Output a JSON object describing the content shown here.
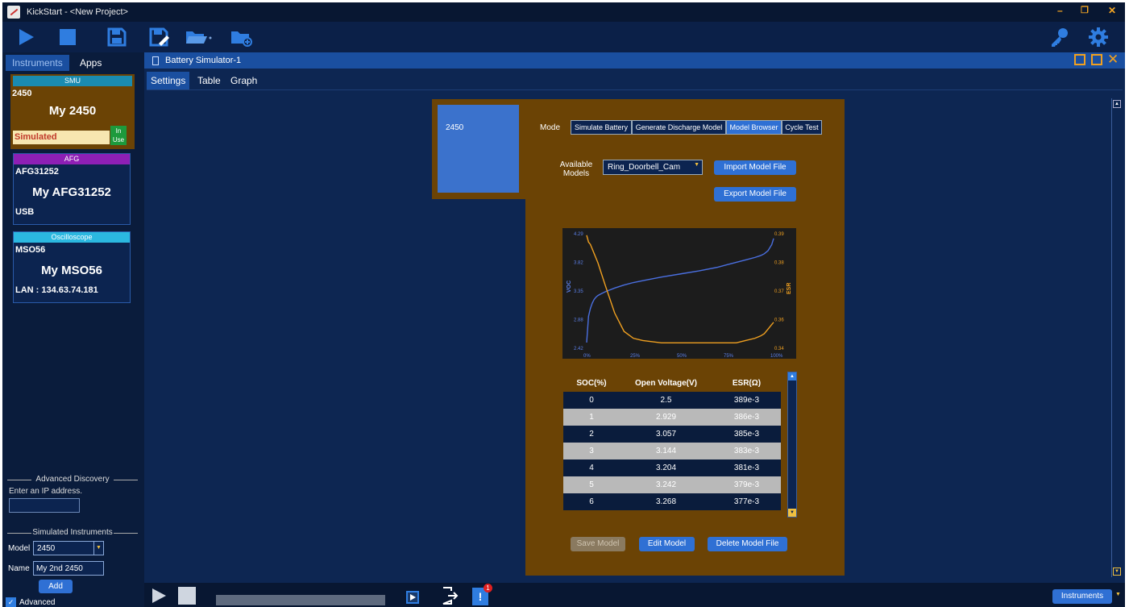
{
  "window": {
    "title": "KickStart - <New Project>"
  },
  "left_tabs": {
    "instruments": "Instruments",
    "apps": "Apps"
  },
  "instruments": [
    {
      "type": "SMU",
      "model": "2450",
      "name": "My 2450",
      "connection": "Simulated",
      "status": "In Use",
      "header_color": "#1a8bb0"
    },
    {
      "type": "AFG",
      "model": "AFG31252",
      "name": "My AFG31252",
      "connection": "USB",
      "header_color": "#8e1fb5"
    },
    {
      "type": "Oscilloscope",
      "model": "MSO56",
      "name": "My MSO56",
      "connection": "LAN : 134.63.74.181",
      "header_color": "#2bb8e0"
    }
  ],
  "advanced_discovery": {
    "label": "Advanced Discovery",
    "ip_prompt": "Enter an IP address.",
    "ip_value": ""
  },
  "simulated": {
    "label": "Simulated Instruments",
    "model_label": "Model",
    "model_value": "2450",
    "name_label": "Name",
    "name_value": "My 2nd 2450",
    "add_label": "Add",
    "advanced_label": "Advanced"
  },
  "doc": {
    "title": "Battery Simulator-1",
    "tabs": [
      "Settings",
      "Table",
      "Graph"
    ],
    "instrument_tile": "2450",
    "mode_label": "Mode",
    "modes": [
      "Simulate Battery",
      "Generate Discharge Model",
      "Model Browser",
      "Cycle Test"
    ],
    "active_mode": "Model Browser",
    "available_models_label": "Available Models",
    "selected_model": "Ring_Doorbell_Cam",
    "import_label": "Import Model File",
    "export_label": "Export Model File",
    "save_label": "Save Model",
    "edit_label": "Edit Model",
    "delete_label": "Delete Model File"
  },
  "chart_data": {
    "type": "line",
    "xlabel": "",
    "ylabel": "VOC",
    "y2label": "ESR",
    "x_ticks": [
      "0%",
      "25%",
      "50%",
      "75%",
      "100%"
    ],
    "y_ticks": [
      "4.29",
      "3.82",
      "3.35",
      "2.88",
      "2.42"
    ],
    "y2_ticks": [
      "0.39",
      "0.38",
      "0.37",
      "0.36",
      "0.34"
    ],
    "ylim": [
      2.42,
      4.29
    ],
    "y2lim": [
      0.34,
      0.39
    ],
    "series": [
      {
        "color": "#4a6fe0",
        "x": [
          0,
          1,
          2,
          3,
          4,
          5,
          6,
          8,
          10,
          15,
          20,
          25,
          30,
          40,
          50,
          60,
          70,
          75,
          80,
          85,
          90,
          93,
          95,
          97,
          99,
          100
        ],
        "values": [
          2.5,
          2.929,
          3.057,
          3.144,
          3.204,
          3.242,
          3.268,
          3.3,
          3.33,
          3.39,
          3.44,
          3.48,
          3.51,
          3.57,
          3.62,
          3.67,
          3.73,
          3.77,
          3.81,
          3.85,
          3.89,
          3.92,
          3.95,
          4.0,
          4.1,
          4.2
        ]
      },
      {
        "color": "#f0a020",
        "x": [
          0,
          1,
          2,
          3,
          4,
          5,
          6,
          8,
          10,
          15,
          20,
          25,
          30,
          40,
          50,
          60,
          70,
          75,
          80,
          85,
          90,
          93,
          95,
          97,
          99,
          100
        ],
        "values": [
          0.389,
          0.386,
          0.385,
          0.383,
          0.381,
          0.379,
          0.377,
          0.372,
          0.367,
          0.355,
          0.347,
          0.344,
          0.343,
          0.342,
          0.342,
          0.342,
          0.342,
          0.342,
          0.342,
          0.343,
          0.344,
          0.345,
          0.346,
          0.348,
          0.35,
          0.351
        ]
      }
    ]
  },
  "table": {
    "headers": [
      "SOC(%)",
      "Open Voltage(V)",
      "ESR(Ω)"
    ],
    "rows": [
      [
        "0",
        "2.5",
        "389e-3"
      ],
      [
        "1",
        "2.929",
        "386e-3"
      ],
      [
        "2",
        "3.057",
        "385e-3"
      ],
      [
        "3",
        "3.144",
        "383e-3"
      ],
      [
        "4",
        "3.204",
        "381e-3"
      ],
      [
        "5",
        "3.242",
        "379e-3"
      ],
      [
        "6",
        "3.268",
        "377e-3"
      ]
    ]
  },
  "bottom": {
    "instruments_button": "Instruments",
    "notification_count": "1"
  }
}
